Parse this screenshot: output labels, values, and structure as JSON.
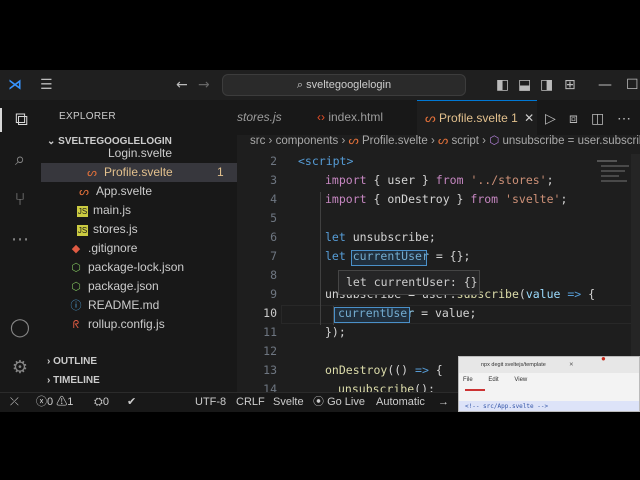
{
  "titlebar": {
    "search_text": "sveltegooglelogin"
  },
  "sidebar": {
    "title": "EXPLORER",
    "project": "SVELTEGOOGLELOGIN",
    "files": [
      {
        "name": "Login.svelte",
        "type": "svelte"
      },
      {
        "name": "Profile.svelte",
        "type": "svelte",
        "badge": "1"
      },
      {
        "name": "App.svelte",
        "type": "svelte"
      },
      {
        "name": "main.js",
        "type": "js"
      },
      {
        "name": "stores.js",
        "type": "js"
      },
      {
        "name": ".gitignore",
        "type": "git"
      },
      {
        "name": "package-lock.json",
        "type": "json"
      },
      {
        "name": "package.json",
        "type": "json"
      },
      {
        "name": "README.md",
        "type": "md"
      },
      {
        "name": "rollup.config.js",
        "type": "rollup"
      }
    ],
    "outline": "OUTLINE",
    "timeline": "TIMELINE"
  },
  "tabs": [
    {
      "label": "stores.js"
    },
    {
      "label": "index.html"
    },
    {
      "label": "Profile.svelte",
      "badge": "1",
      "close": "✕"
    }
  ],
  "breadcrumb": [
    "src",
    "components",
    "Profile.svelte",
    "script",
    "unsubscribe = user.subscribe() callback"
  ],
  "editor": {
    "line_numbers": [
      "2",
      "3",
      "4",
      "5",
      "6",
      "7",
      "8",
      "9",
      "10",
      "11",
      "12",
      "13",
      "14"
    ],
    "hover_text": "let currentUser: {}"
  },
  "statusbar": {
    "errors": "0",
    "warnings": "1",
    "ports": "0",
    "encoding": "UTF-8",
    "eol": "CRLF",
    "language": "Svelte",
    "golive": "Go Live",
    "indent": "Automatic"
  },
  "popup_window": {
    "tab_title": "npx degit sveltejs/template",
    "menu": [
      "File",
      "Edit",
      "View"
    ],
    "snippet": "<!-- src/App.svelte -->"
  },
  "colors": {
    "accent": "#0078d4",
    "svelte": "#e2703a",
    "modified": "#e2c08d"
  }
}
